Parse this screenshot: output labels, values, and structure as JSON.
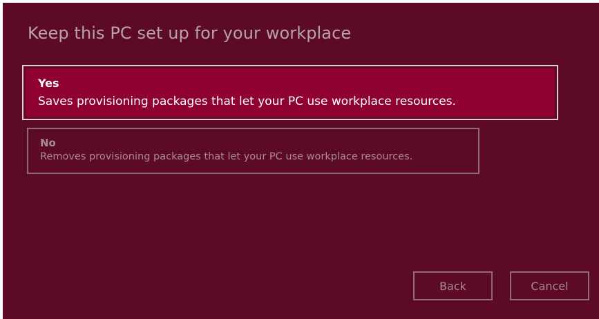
{
  "dialog": {
    "title": "Keep this PC set up for your workplace"
  },
  "options": {
    "yes": {
      "title": "Yes",
      "description": "Saves provisioning packages that let your PC use workplace resources."
    },
    "no": {
      "title": "No",
      "description": "Removes provisioning packages that let your PC use workplace resources."
    }
  },
  "buttons": {
    "back_label": "Back",
    "cancel_label": "Cancel"
  },
  "colors": {
    "background": "#5c0a28",
    "selected_fill": "#900233",
    "selected_border": "#e9c8d3",
    "disabled_text": "#a78b95"
  }
}
